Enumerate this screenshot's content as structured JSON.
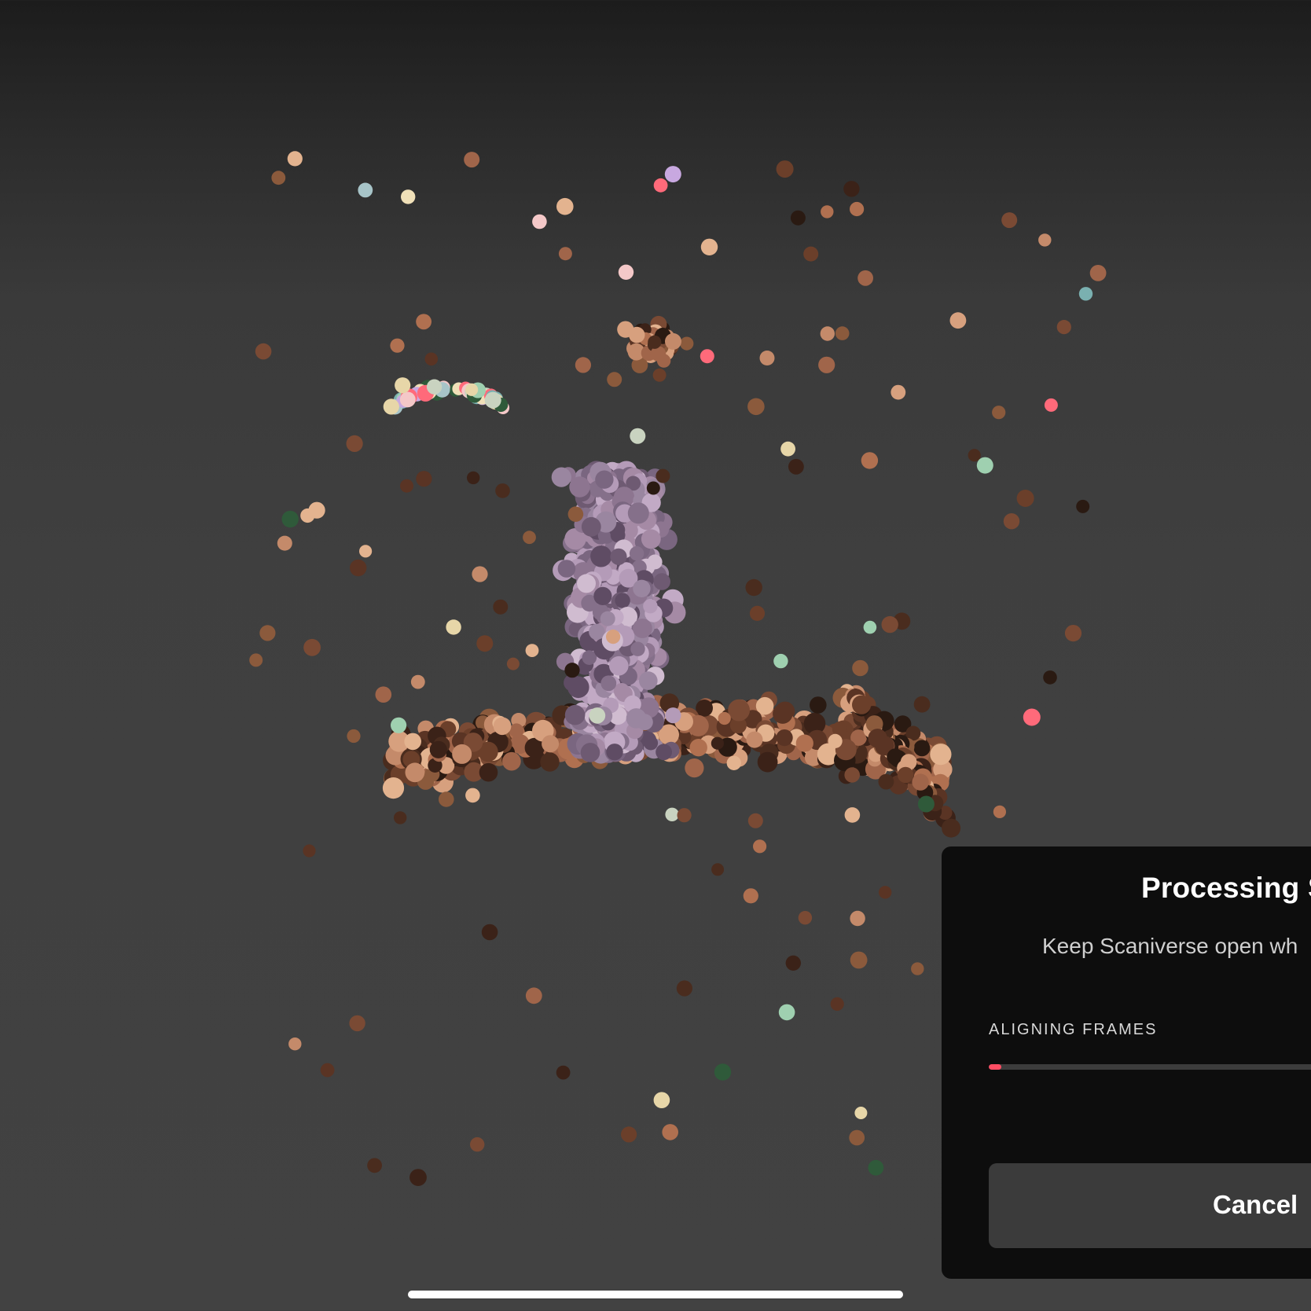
{
  "app": "Scaniverse",
  "dialog": {
    "title": "Processing S",
    "subtitle": "Keep Scaniverse open wh",
    "step_label": "ALIGNING FRAMES",
    "progress": 0.035,
    "cancel_label": "Cancel"
  },
  "colors": {
    "panel_bg": "#0d0d0d",
    "progress_fill": "#ff4d63",
    "progress_track": "#3c3c3c",
    "button_bg": "#3b3b3b",
    "text_primary": "#ffffff",
    "text_secondary": "#cfcfcf"
  }
}
